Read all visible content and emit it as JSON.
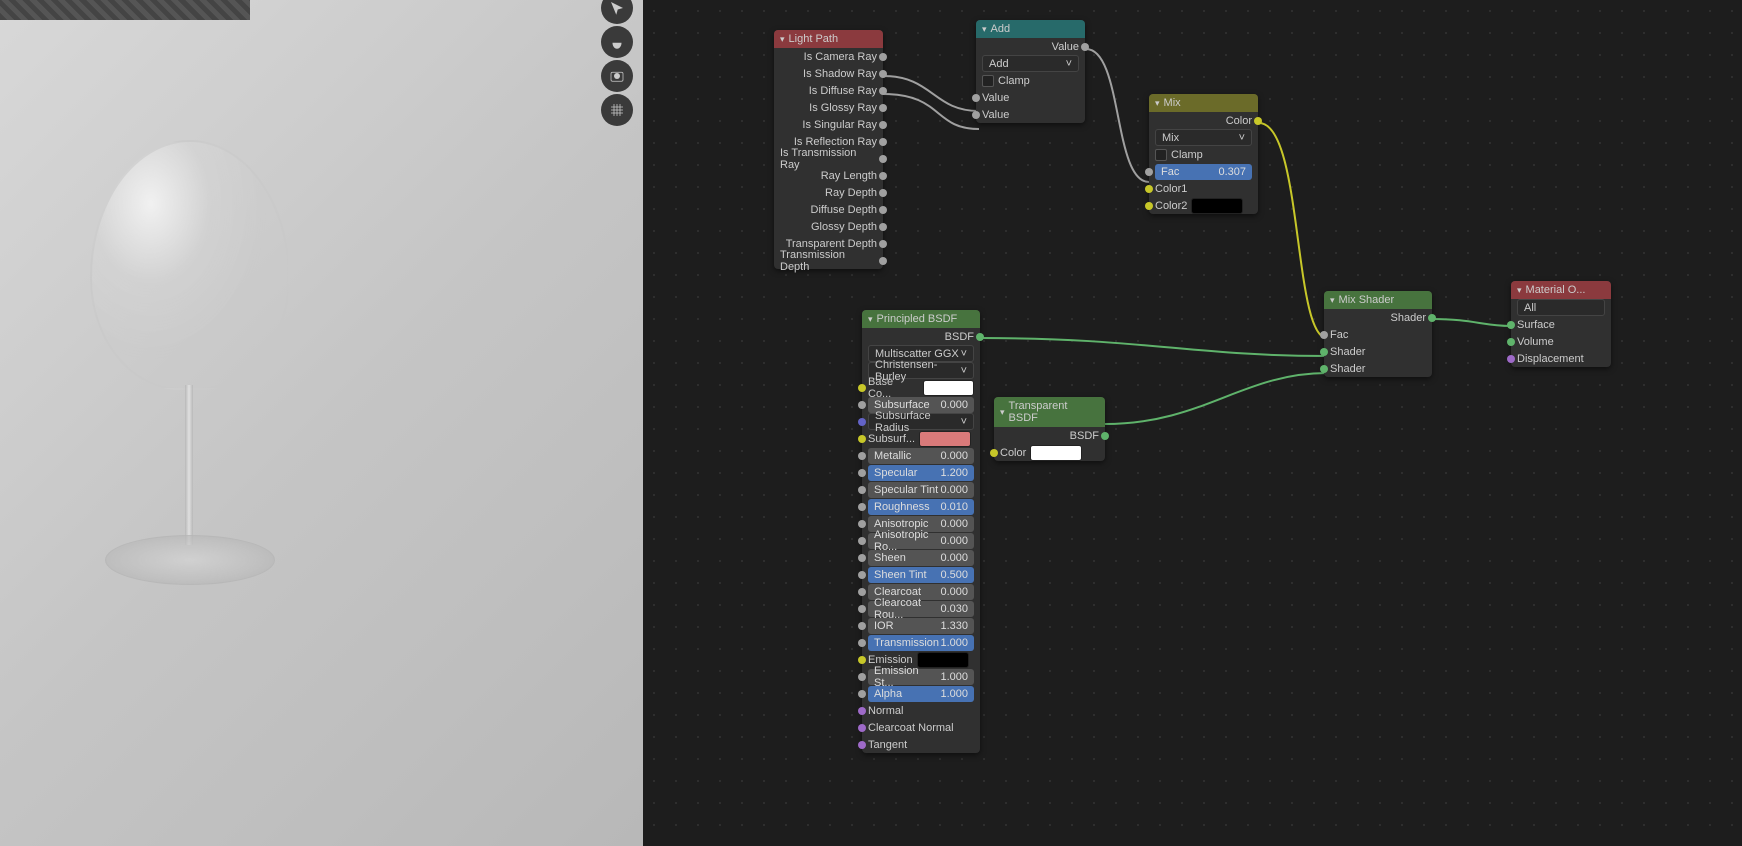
{
  "viewport_tools": [
    "arrow",
    "hand",
    "camera",
    "grid"
  ],
  "nodes": {
    "lightpath": {
      "title": "Light Path",
      "outputs": [
        "Is Camera Ray",
        "Is Shadow Ray",
        "Is Diffuse Ray",
        "Is Glossy Ray",
        "Is Singular Ray",
        "Is Reflection Ray",
        "Is Transmission Ray",
        "Ray Length",
        "Ray Depth",
        "Diffuse Depth",
        "Glossy Depth",
        "Transparent Depth",
        "Transmission Depth"
      ]
    },
    "add": {
      "title": "Add",
      "out": "Value",
      "mode": "Add",
      "clamp": "Clamp",
      "in1": "Value",
      "in2": "Value"
    },
    "mix": {
      "title": "Mix",
      "out": "Color",
      "mode": "Mix",
      "clamp": "Clamp",
      "fac_lbl": "Fac",
      "fac_val": "0.307",
      "c1": "Color1",
      "c2": "Color2"
    },
    "principled": {
      "title": "Principled BSDF",
      "out": "BSDF",
      "dist": "Multiscatter GGX",
      "sss": "Christensen-Burley",
      "base_lbl": "Base Co...",
      "rows": [
        {
          "lbl": "Subsurface",
          "val": "0.000",
          "blue": false,
          "sock": "gray"
        },
        {
          "lbl": "Subsurface Radius",
          "dd": true,
          "sock": "blue"
        },
        {
          "lbl": "Subsurf...",
          "swatch": "#d97a7a",
          "sock": "yellow"
        },
        {
          "lbl": "Metallic",
          "val": "0.000",
          "blue": false,
          "sock": "gray"
        },
        {
          "lbl": "Specular",
          "val": "1.200",
          "blue": true,
          "sock": "gray"
        },
        {
          "lbl": "Specular Tint",
          "val": "0.000",
          "blue": false,
          "sock": "gray"
        },
        {
          "lbl": "Roughness",
          "val": "0.010",
          "blue": true,
          "sock": "gray"
        },
        {
          "lbl": "Anisotropic",
          "val": "0.000",
          "blue": false,
          "sock": "gray"
        },
        {
          "lbl": "Anisotropic Ro...",
          "val": "0.000",
          "blue": false,
          "sock": "gray"
        },
        {
          "lbl": "Sheen",
          "val": "0.000",
          "blue": false,
          "sock": "gray"
        },
        {
          "lbl": "Sheen Tint",
          "val": "0.500",
          "blue": true,
          "sock": "gray"
        },
        {
          "lbl": "Clearcoat",
          "val": "0.000",
          "blue": false,
          "sock": "gray"
        },
        {
          "lbl": "Clearcoat Rou...",
          "val": "0.030",
          "blue": false,
          "sock": "gray"
        },
        {
          "lbl": "IOR",
          "val": "1.330",
          "blue": false,
          "sock": "gray"
        },
        {
          "lbl": "Transmission",
          "val": "1.000",
          "blue": true,
          "sock": "gray"
        }
      ],
      "emission_lbl": "Emission",
      "emstr": {
        "lbl": "Emission St...",
        "val": "1.000"
      },
      "alpha": {
        "lbl": "Alpha",
        "val": "1.000"
      },
      "normal": "Normal",
      "cnormal": "Clearcoat Normal",
      "tangent": "Tangent"
    },
    "transparent": {
      "title": "Transparent BSDF",
      "out": "BSDF",
      "color": "Color"
    },
    "mixshader": {
      "title": "Mix Shader",
      "out": "Shader",
      "fac": "Fac",
      "s1": "Shader",
      "s2": "Shader"
    },
    "matout": {
      "title": "Material O...",
      "target": "All",
      "surface": "Surface",
      "volume": "Volume",
      "disp": "Displacement"
    }
  }
}
